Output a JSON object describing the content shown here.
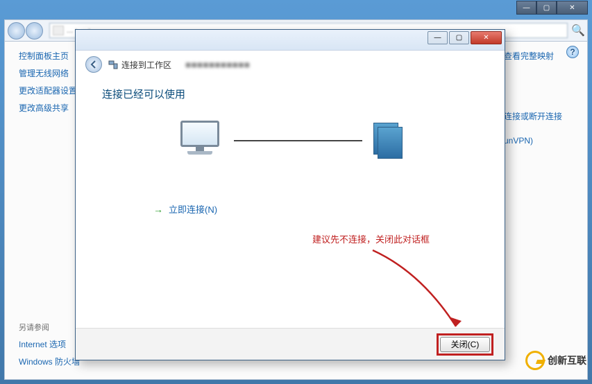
{
  "parent_window": {
    "min": "—",
    "max": "▢",
    "close": "✕"
  },
  "explorer": {
    "breadcrumb_blur": "... › ... › ...",
    "help_tooltip": "?",
    "sidebar": {
      "heading": "控制面板主页",
      "items": [
        "管理无线网络",
        "更改适配器设置",
        "更改高级共享"
      ],
      "see_also_label": "另请参阅",
      "see_also_items": [
        "Internet 选项",
        "Windows 防火墙"
      ]
    },
    "right_links": [
      "查看完整映射",
      "连接或断开连接",
      "unVPN)"
    ]
  },
  "wizard": {
    "titlebar": {
      "min": "—",
      "max": "▢",
      "close": "✕"
    },
    "header_text": "连接到工作区",
    "blurred_subtitle": "■■■■■■■■■■■",
    "message": "连接已经可以使用",
    "connect_now": "立即连接(N)",
    "connect_arrow": "→",
    "close_button": "关闭(C)"
  },
  "annotation": "建议先不连接，关闭此对话框",
  "watermark": "创新互联"
}
